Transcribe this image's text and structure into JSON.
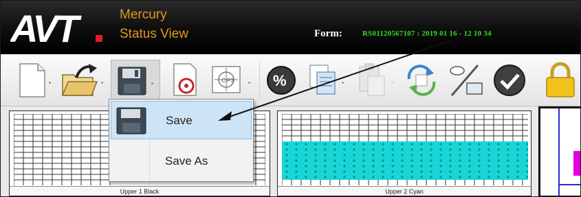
{
  "header": {
    "logo_text": "AVT.",
    "app_name": "Mercury",
    "app_view": "Status View",
    "form_label": "Form:",
    "form_value": "RS01120567107 : 2019 01 16 - 12 10 34"
  },
  "toolbar": {
    "icons": [
      "new-document-icon",
      "open-folder-icon",
      "save-icon",
      "print-preview-icon",
      "cip3-icon",
      "percent-icon",
      "copy-icon",
      "paste-icon",
      "refresh-icon",
      "format-icon",
      "checkmark-icon",
      "lock-icon"
    ]
  },
  "menu": {
    "items": [
      {
        "label": "Save",
        "selected": true
      },
      {
        "label": "Save As",
        "selected": false
      }
    ]
  },
  "panels": [
    {
      "label": "Upper 1 Black"
    },
    {
      "label": "Upper 2 Cyan"
    }
  ],
  "colors": {
    "accent_orange": "#e29a1a",
    "form_value_green": "#33dd22",
    "cyan_ink": "#19d6d6",
    "magenta_ink": "#e000e0",
    "menu_highlight": "#cde4f7"
  }
}
